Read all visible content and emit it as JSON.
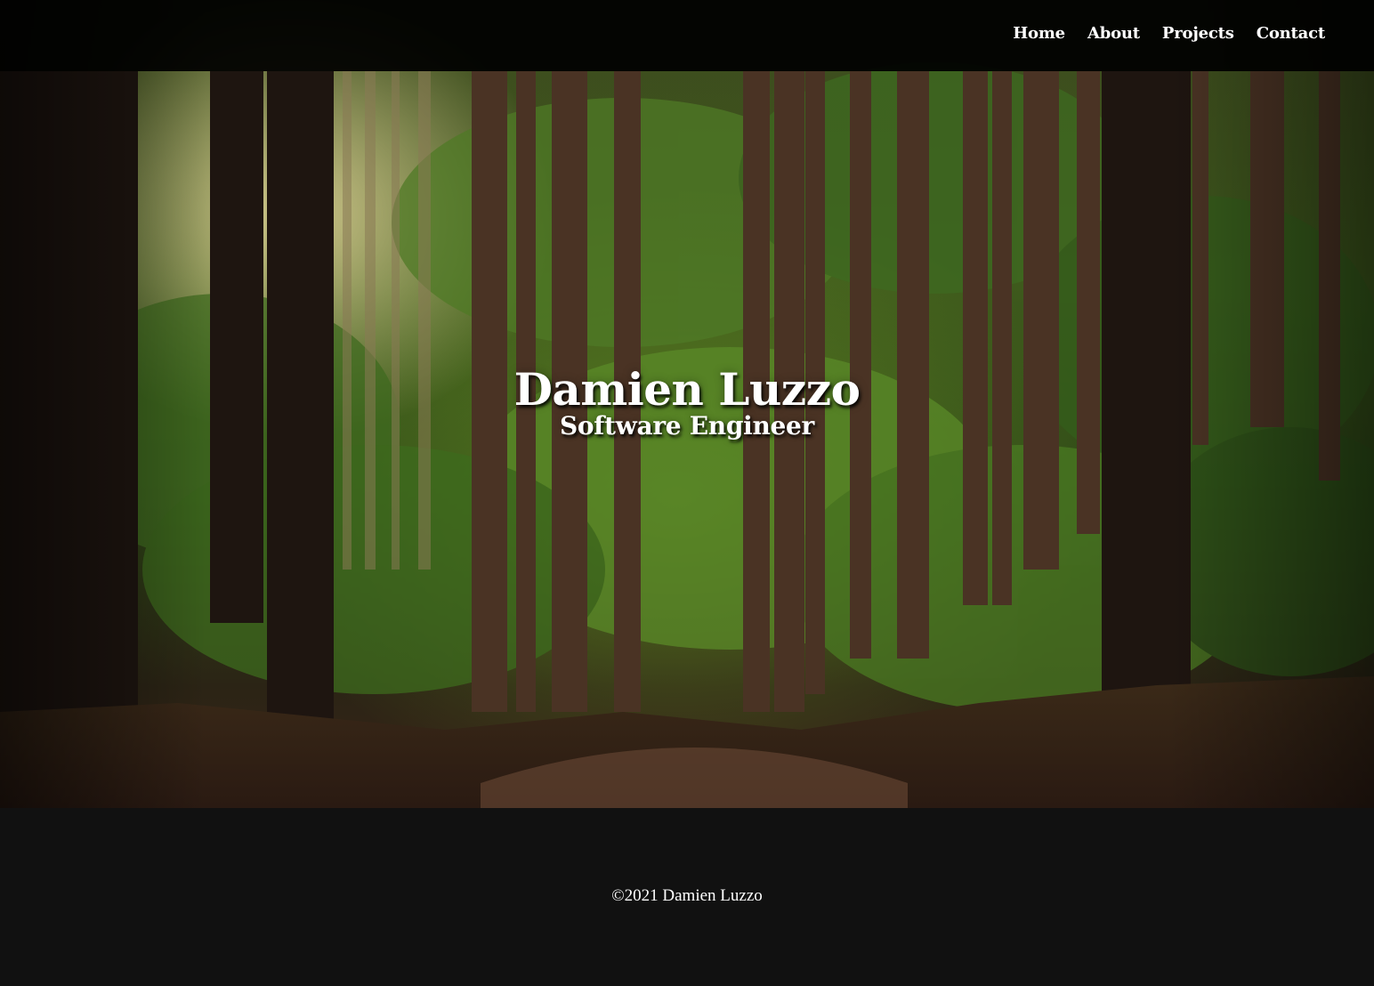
{
  "nav": {
    "items": [
      {
        "label": "Home"
      },
      {
        "label": "About"
      },
      {
        "label": "Projects"
      },
      {
        "label": "Contact"
      }
    ]
  },
  "hero": {
    "name": "Damien Luzzo",
    "role": "Software Engineer",
    "background": "forest-photo"
  },
  "footer": {
    "copyright": "©2021 Damien Luzzo"
  },
  "colors": {
    "navbar": "#000000",
    "footer": "#111111",
    "text": "#ffffff"
  }
}
